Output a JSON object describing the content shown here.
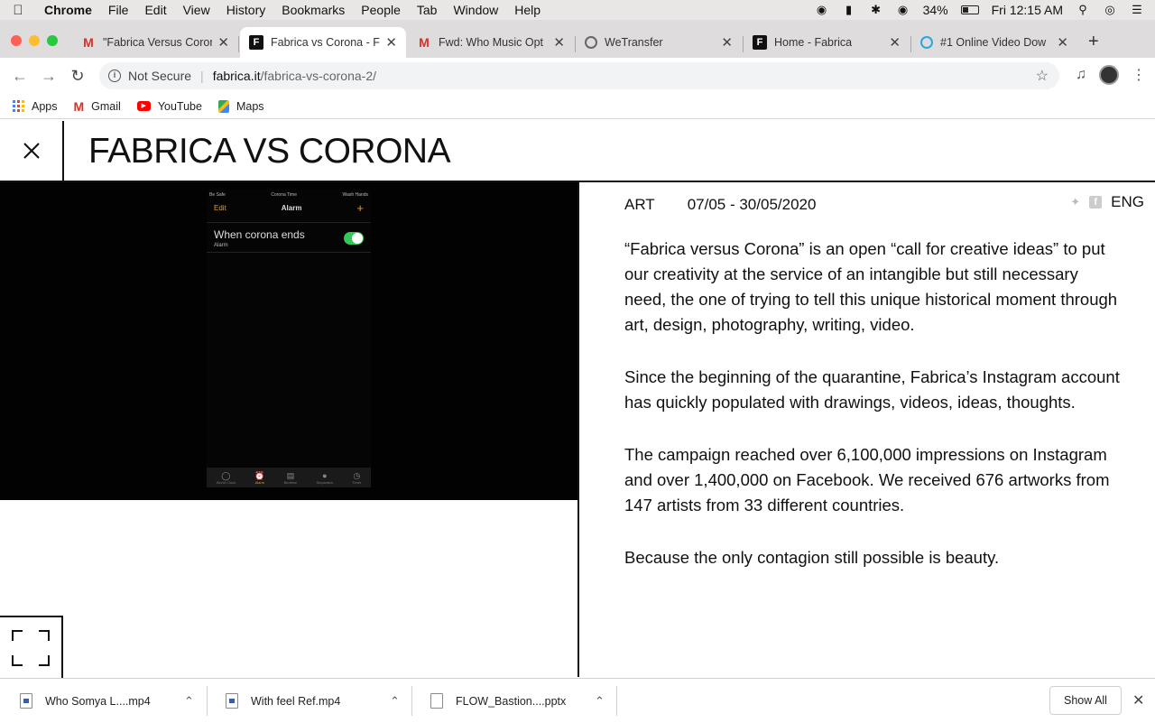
{
  "menubar": {
    "items": [
      "Chrome",
      "File",
      "Edit",
      "View",
      "History",
      "Bookmarks",
      "People",
      "Tab",
      "Window",
      "Help"
    ],
    "battery": "34%",
    "clock": "Fri 12:15 AM"
  },
  "tabs": [
    {
      "title": "\"Fabrica Versus Coron",
      "icon": "gmail-icon"
    },
    {
      "title": "Fabrica vs Corona - F",
      "icon": "fabrica-icon",
      "active": true
    },
    {
      "title": "Fwd: Who Music Opt",
      "icon": "gmail-icon"
    },
    {
      "title": "WeTransfer",
      "icon": "globe-icon"
    },
    {
      "title": "Home - Fabrica",
      "icon": "fabrica-icon"
    },
    {
      "title": "#1 Online Video Dow",
      "icon": "download-icon"
    }
  ],
  "omnibox": {
    "security": "Not Secure",
    "host": "fabrica.it",
    "path": "/fabrica-vs-corona-2/"
  },
  "bookmarks": [
    "Apps",
    "Gmail",
    "YouTube",
    "Maps"
  ],
  "page": {
    "title": "FABRICA VS CORONA",
    "category": "ART",
    "dates": "07/05 - 30/05/2020",
    "lang": "ENG",
    "paragraphs": [
      "“Fabrica versus Corona” is an open “call for creative ideas” to put our creativity at the service of an intangible but still necessary need, the one of trying to tell this unique historical moment through art, design, photography, writing, video.",
      "Since the beginning of the quarantine, Fabrica’s Instagram account has quickly populated with drawings, videos, ideas, thoughts.",
      "The campaign reached over 6,100,000 impressions on Instagram and over 1,400,000 on Facebook. We received 676 artworks from 147 artists from 33 different countries.",
      "Because the only contagion still possible is beauty."
    ]
  },
  "video_frame": {
    "status_left": "Be Safe",
    "status_center": "Corona Time",
    "status_right": "Wash Hands",
    "edit": "Edit",
    "title": "Alarm",
    "plus": "+",
    "alarm_label": "When corona ends",
    "alarm_sub": "Alarm",
    "tabbar": [
      "World Clock",
      "Alarm",
      "Bedtime",
      "Stopwatch",
      "Timer"
    ]
  },
  "downloads": {
    "items": [
      "Who Somya L....mp4",
      "With feel Ref.mp4",
      "FLOW_Bastion....pptx"
    ],
    "show_all": "Show All"
  }
}
